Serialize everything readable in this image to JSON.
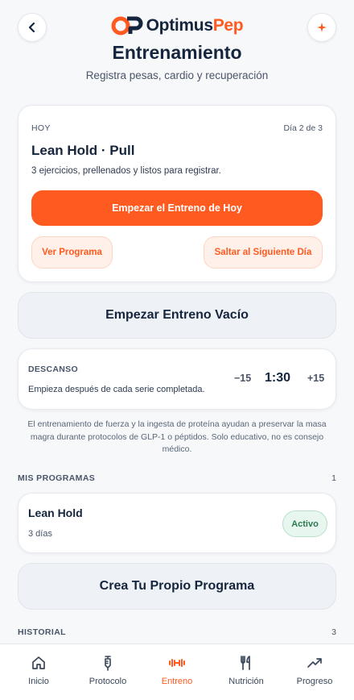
{
  "colors": {
    "accent": "#ff5a1f",
    "navy": "#14253d",
    "active_badge": "#2b7a4f"
  },
  "header": {
    "back_icon": "chevron-left-icon",
    "brand_part1": "Optimus",
    "brand_part2": "Pep",
    "sparkle_icon": "sparkle-icon",
    "title": "Entrenamiento",
    "subtitle": "Registra pesas, cardio y recuperación"
  },
  "today": {
    "kicker": "HOY",
    "day": "Día 2 de 3",
    "workout_title": "Lean Hold · Pull",
    "description": "3 ejercicios, prellenados y listos para registrar.",
    "start_button": "Empezar el Entreno de Hoy",
    "program_button": "Ver Programa",
    "skip_button": "Saltar al Siguiente Día"
  },
  "empty_workout_button": "Empezar Entreno Vacío",
  "rest": {
    "label": "DESCANSO",
    "description": "Empieza después de cada serie completada.",
    "minus": "−15",
    "timer": "1:30",
    "plus": "+15"
  },
  "disclaimer": "El entrenamiento de fuerza y la ingesta de proteína ayudan a preservar la masa magra durante protocolos de GLP-1 o péptidos. Solo educativo, no es consejo médico.",
  "programs": {
    "label": "MIS PROGRAMAS",
    "count": "1",
    "items": [
      {
        "name": "Lean Hold",
        "days": "3 días",
        "status": "Activo"
      }
    ]
  },
  "create_button": "Crea Tu Propio Programa",
  "history": {
    "label": "HISTORIAL",
    "count": "3"
  },
  "nav": {
    "items": [
      {
        "label": "Inicio",
        "icon": "home-icon",
        "active": false
      },
      {
        "label": "Protocolo",
        "icon": "syringe-icon",
        "active": false
      },
      {
        "label": "Entreno",
        "icon": "dumbbell-icon",
        "active": true
      },
      {
        "label": "Nutrición",
        "icon": "utensils-icon",
        "active": false
      },
      {
        "label": "Progreso",
        "icon": "trending-up-icon",
        "active": false
      }
    ]
  }
}
